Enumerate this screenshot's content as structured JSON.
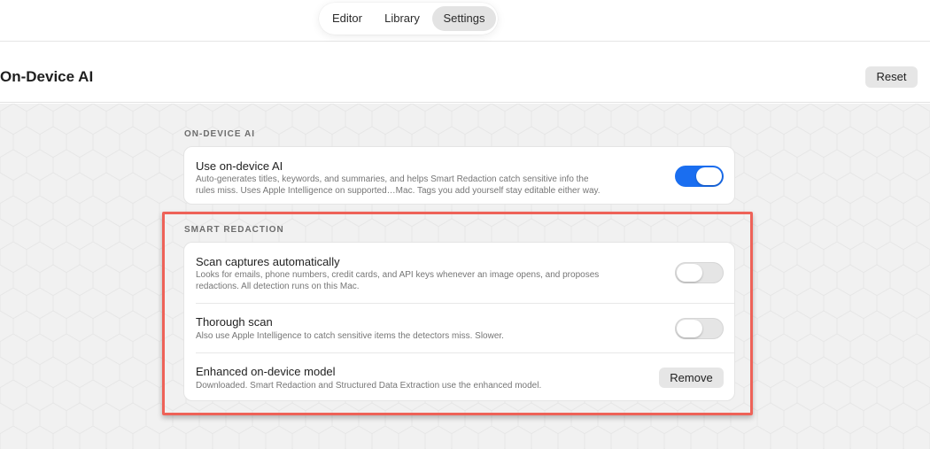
{
  "tabs": [
    {
      "label": "Editor",
      "active": false
    },
    {
      "label": "Library",
      "active": false
    },
    {
      "label": "Settings",
      "active": true
    }
  ],
  "header": {
    "title": "On-Device AI",
    "reset_label": "Reset"
  },
  "sections": {
    "on_device_ai": {
      "label": "ON-DEVICE AI",
      "use_ai": {
        "title": "Use on-device AI",
        "desc_line1": "Auto-generates titles, keywords, and summaries, and helps Smart Redaction catch sensitive info the",
        "desc_line2": "rules miss. Uses Apple Intelligence on supported…Mac. Tags you add yourself stay editable either way.",
        "enabled": true
      }
    },
    "smart_redaction": {
      "label": "SMART REDACTION",
      "scan_auto": {
        "title": "Scan captures automatically",
        "desc_line1": "Looks for emails, phone numbers, credit cards, and API keys whenever an image opens, and proposes",
        "desc_line2": "redactions. All detection runs on this Mac.",
        "enabled": false
      },
      "thorough": {
        "title": "Thorough scan",
        "desc": "Also use Apple Intelligence to catch sensitive items the detectors miss. Slower.",
        "enabled": false
      },
      "enhanced_model": {
        "title": "Enhanced on-device model",
        "desc": "Downloaded. Smart Redaction and Structured Data Extraction use the enhanced model.",
        "remove_label": "Remove"
      }
    }
  },
  "colors": {
    "accent": "#1a6ef0",
    "highlight": "#ee6258"
  }
}
